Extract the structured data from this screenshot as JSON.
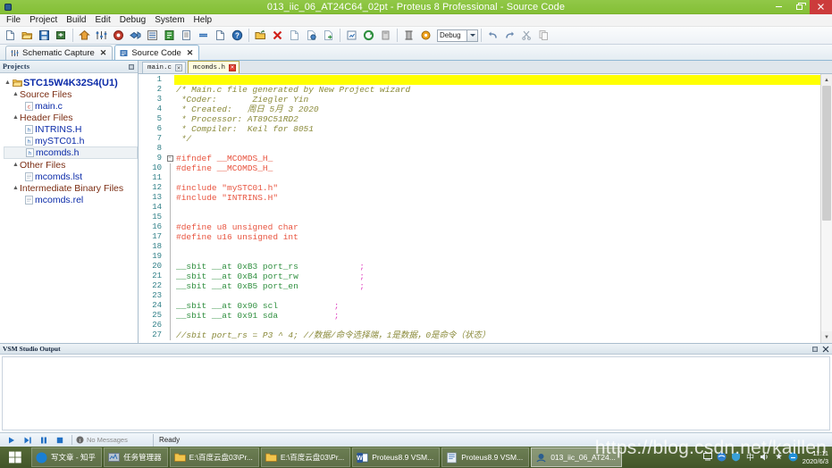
{
  "window": {
    "title": "013_iic_06_AT24C64_02pt - Proteus 8 Professional - Source Code",
    "minimize_label": "–",
    "restore_label": "❐",
    "close_label": "✕"
  },
  "menu": {
    "items": [
      "File",
      "Project",
      "Build",
      "Edit",
      "Debug",
      "System",
      "Help"
    ]
  },
  "toolbar": {
    "combo_value": "Debug",
    "buttons": [
      {
        "name": "new-project",
        "icon": "page-white-icon"
      },
      {
        "name": "open-project",
        "icon": "folder-open-icon"
      },
      {
        "name": "save-project",
        "icon": "floppy-save-icon"
      },
      {
        "name": "import-project",
        "icon": "import-icon"
      },
      {
        "name": "home-page",
        "icon": "home-icon"
      },
      {
        "name": "schematic-capture",
        "icon": "schematic-icon"
      },
      {
        "name": "pcb-layout",
        "icon": "pcb-target-icon"
      },
      {
        "name": "3d-visualiser",
        "icon": "cube-3d-icon"
      },
      {
        "name": "design-explorer",
        "icon": "design-explorer-icon"
      },
      {
        "name": "source-code",
        "icon": "source-code-icon"
      },
      {
        "name": "bill-of-materials",
        "icon": "bom-icon"
      },
      {
        "name": "project-notes",
        "icon": "notes-icon"
      },
      {
        "name": "project-clips",
        "icon": "clips-icon"
      },
      {
        "name": "help-topics",
        "icon": "help-question-icon"
      },
      {
        "name": "add-files",
        "icon": "add-folder-icon"
      },
      {
        "name": "remove-files",
        "icon": "remove-red-x-icon"
      },
      {
        "name": "new-source-file",
        "icon": "new-file-icon"
      },
      {
        "name": "copy-file",
        "icon": "copy-file-icon"
      },
      {
        "name": "paste-file",
        "icon": "paste-file-icon"
      },
      {
        "name": "build-project",
        "icon": "build-icon"
      },
      {
        "name": "rebuild-project",
        "icon": "rebuild-icon"
      },
      {
        "name": "clean-project",
        "icon": "clean-icon"
      },
      {
        "name": "project-settings",
        "icon": "settings-column-icon"
      },
      {
        "name": "flash-settings",
        "icon": "flash-gear-icon"
      },
      {
        "name": "undo",
        "icon": "undo-arrow-icon"
      },
      {
        "name": "redo",
        "icon": "redo-arrow-icon"
      },
      {
        "name": "cut",
        "icon": "scissors-icon"
      },
      {
        "name": "copy",
        "icon": "copy-icon"
      }
    ]
  },
  "main_tabs": [
    {
      "label": "Schematic Capture",
      "icon": "schematic-icon",
      "active": false,
      "close": "✕"
    },
    {
      "label": "Source Code",
      "icon": "source-code-icon",
      "active": true,
      "close": "✕"
    }
  ],
  "projects_panel": {
    "title": "Projects",
    "pin_icon": "pin-icon",
    "tree": [
      {
        "level": 0,
        "label": "STC15W4K32S4(U1)",
        "type": "root",
        "icon": "folder-open-icon",
        "expanded": true
      },
      {
        "level": 1,
        "label": "Source Files",
        "type": "group",
        "icon": "none",
        "expanded": true
      },
      {
        "level": 2,
        "label": "main.c",
        "type": "file",
        "icon": "c-file-icon",
        "selected": false
      },
      {
        "level": 1,
        "label": "Header Files",
        "type": "group",
        "icon": "none",
        "expanded": true
      },
      {
        "level": 2,
        "label": "INTRINS.H",
        "type": "file",
        "icon": "h-file-icon",
        "selected": false
      },
      {
        "level": 2,
        "label": "mySTC01.h",
        "type": "file",
        "icon": "h-file-icon",
        "selected": false
      },
      {
        "level": 2,
        "label": "mcomds.h",
        "type": "file",
        "icon": "h-file-icon",
        "selected": true
      },
      {
        "level": 1,
        "label": "Other Files",
        "type": "group",
        "icon": "none",
        "expanded": true
      },
      {
        "level": 2,
        "label": "mcomds.lst",
        "type": "file",
        "icon": "txt-file-icon",
        "selected": false
      },
      {
        "level": 1,
        "label": "Intermediate Binary Files",
        "type": "group",
        "icon": "none",
        "expanded": true
      },
      {
        "level": 2,
        "label": "mcomds.rel",
        "type": "file",
        "icon": "txt-file-icon",
        "selected": false
      }
    ]
  },
  "editor": {
    "tabs": [
      {
        "label": "main.c",
        "active": false,
        "close": "✕"
      },
      {
        "label": "mcomds.h",
        "active": true,
        "close": "✕"
      }
    ],
    "lines": [
      {
        "n": 1,
        "text": "",
        "style": "plain",
        "highlight": true,
        "fold": ""
      },
      {
        "n": 2,
        "text": "/* Main.c file generated by New Project wizard",
        "style": "comment",
        "fold": ""
      },
      {
        "n": 3,
        "text": " *Coder:       Ziegler Yin",
        "style": "comment",
        "fold": ""
      },
      {
        "n": 4,
        "text": " * Created:   周日 5月 3 2020",
        "style": "comment",
        "fold": ""
      },
      {
        "n": 5,
        "text": " * Processor: AT89C51RD2",
        "style": "comment",
        "fold": ""
      },
      {
        "n": 6,
        "text": " * Compiler:  Keil for 8051",
        "style": "comment",
        "fold": ""
      },
      {
        "n": 7,
        "text": " */",
        "style": "comment",
        "fold": ""
      },
      {
        "n": 8,
        "text": "",
        "style": "plain",
        "fold": ""
      },
      {
        "n": 9,
        "text": "#ifndef __MCOMDS_H_",
        "style": "pre",
        "fold": "minus"
      },
      {
        "n": 10,
        "text": "#define __MCOMDS_H_",
        "style": "pre",
        "fold": "line"
      },
      {
        "n": 11,
        "text": "",
        "style": "plain",
        "fold": "line"
      },
      {
        "n": 12,
        "text": "#include \"mySTC01.h\"",
        "style": "pre",
        "fold": "line"
      },
      {
        "n": 13,
        "text": "#include \"INTRINS.H\"",
        "style": "pre",
        "fold": "line"
      },
      {
        "n": 14,
        "text": "",
        "style": "plain",
        "fold": "line"
      },
      {
        "n": 15,
        "text": "",
        "style": "plain",
        "fold": "line"
      },
      {
        "n": 16,
        "text": "#define u8 unsigned char",
        "style": "pre",
        "fold": "line"
      },
      {
        "n": 17,
        "text": "#define u16 unsigned int",
        "style": "pre",
        "fold": "line"
      },
      {
        "n": 18,
        "text": "",
        "style": "plain",
        "fold": "line"
      },
      {
        "n": 19,
        "text": "",
        "style": "plain",
        "fold": "line"
      },
      {
        "n": 20,
        "text": "__sbit __at 0xB3 port_rs",
        "style": "sbit",
        "semi": ";",
        "semi_col": 36,
        "fold": "line"
      },
      {
        "n": 21,
        "text": "__sbit __at 0xB4 port_rw",
        "style": "sbit",
        "semi": ";",
        "semi_col": 36,
        "fold": "line"
      },
      {
        "n": 22,
        "text": "__sbit __at 0xB5 port_en",
        "style": "sbit",
        "semi": ";",
        "semi_col": 36,
        "fold": "line"
      },
      {
        "n": 23,
        "text": "",
        "style": "plain",
        "fold": "line"
      },
      {
        "n": 24,
        "text": "__sbit __at 0x90 scl",
        "style": "sbit",
        "semi": ";",
        "semi_col": 31,
        "fold": "line"
      },
      {
        "n": 25,
        "text": "__sbit __at 0x91 sda",
        "style": "sbit",
        "semi": ";",
        "semi_col": 31,
        "fold": "line"
      },
      {
        "n": 26,
        "text": "",
        "style": "plain",
        "fold": "line"
      },
      {
        "n": 27,
        "text": "//sbit port_rs = P3 ^ 4; //数据/命令选择端，1是数据，0是命令（状态）",
        "style": "comment",
        "fold": "line"
      }
    ]
  },
  "output_panel": {
    "title": "VSM Studio Output",
    "pin_icon": "pin-icon",
    "close_icon": "close-icon",
    "content": ""
  },
  "statusbar": {
    "buttons": [
      {
        "name": "run-button",
        "icon": "play-icon"
      },
      {
        "name": "step-button",
        "icon": "step-icon"
      },
      {
        "name": "pause-button",
        "icon": "pause-icon"
      },
      {
        "name": "stop-button",
        "icon": "stop-icon"
      }
    ],
    "messages": "No Messages",
    "status": "Ready"
  },
  "taskbar": {
    "start_icon": "windows-start-icon",
    "tasks": [
      {
        "label": "写文章 - 知乎",
        "icon": "browser-icon",
        "active": false
      },
      {
        "label": "任务管理器",
        "icon": "task-manager-icon",
        "active": false
      },
      {
        "label": "E:\\百度云盘03\\Pr...",
        "icon": "folder-icon",
        "active": false
      },
      {
        "label": "E:\\百度云盘03\\Pr...",
        "icon": "folder-icon",
        "active": false
      },
      {
        "label": "Proteus8.9 VSM...",
        "icon": "word-icon",
        "active": false
      },
      {
        "label": "Proteus8.9 VSM...",
        "icon": "proteus-icon",
        "active": false
      },
      {
        "label": "013_iic_06_AT24...",
        "icon": "proteus-icon",
        "active": true
      }
    ],
    "tray_icons": [
      "show-desktop-icon",
      "network-icon",
      "security-shield-icon",
      "input-method-icon",
      "volume-icon",
      "action-center-icon",
      "cloud-icon"
    ],
    "clock_time": "11:11",
    "clock_date": "2020/6/3"
  },
  "watermark": {
    "text": "https://blog.csdn.net/kaillen"
  },
  "colors": {
    "title_bar": "#8cc63f",
    "close_button": "#cc3b3b",
    "highlight_line": "#ffff00",
    "comment": "#8a8a3a",
    "preprocessor": "#e8543f",
    "keyword": "#2f8f3f",
    "semicolon": "#e040c0",
    "tree_file": "#0a2aa8",
    "tree_group": "#7b2d13"
  }
}
